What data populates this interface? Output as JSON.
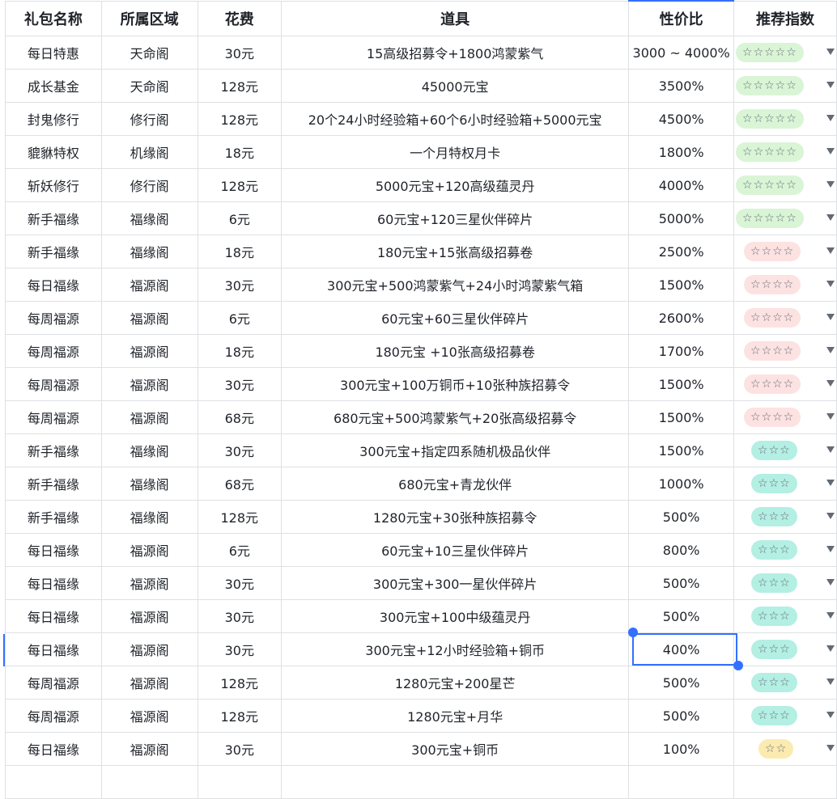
{
  "headers": [
    "礼包名称",
    "所属区域",
    "花费",
    "道具",
    "性价比",
    "推荐指数"
  ],
  "rows": [
    {
      "name": "每日特惠",
      "area": "天命阁",
      "cost": "30元",
      "items": "15高级招募令+1800鸿蒙紫气",
      "ratio": "3000 ~ 4000%",
      "stars": "☆☆☆☆☆",
      "color": "green"
    },
    {
      "name": "成长基金",
      "area": "天命阁",
      "cost": "128元",
      "items": "45000元宝",
      "ratio": "3500%",
      "stars": "☆☆☆☆☆",
      "color": "green"
    },
    {
      "name": "封鬼修行",
      "area": "修行阁",
      "cost": "128元",
      "items": "20个24小时经验箱+60个6小时经验箱+5000元宝",
      "ratio": "4500%",
      "stars": "☆☆☆☆☆",
      "color": "green"
    },
    {
      "name": "貔貅特权",
      "area": "机缘阁",
      "cost": "18元",
      "items": "一个月特权月卡",
      "ratio": "1800%",
      "stars": "☆☆☆☆☆",
      "color": "green"
    },
    {
      "name": "斩妖修行",
      "area": "修行阁",
      "cost": "128元",
      "items": "5000元宝+120高级蕴灵丹",
      "ratio": "4000%",
      "stars": "☆☆☆☆☆",
      "color": "green"
    },
    {
      "name": "新手福缘",
      "area": "福缘阁",
      "cost": "6元",
      "items": "60元宝+120三星伙伴碎片",
      "ratio": "5000%",
      "stars": "☆☆☆☆☆",
      "color": "green"
    },
    {
      "name": "新手福缘",
      "area": "福缘阁",
      "cost": "18元",
      "items": "180元宝+15张高级招募卷",
      "ratio": "2500%",
      "stars": "☆☆☆☆",
      "color": "pink"
    },
    {
      "name": "每日福缘",
      "area": "福源阁",
      "cost": "30元",
      "items": "300元宝+500鸿蒙紫气+24小时鸿蒙紫气箱",
      "ratio": "1500%",
      "stars": "☆☆☆☆",
      "color": "pink"
    },
    {
      "name": "每周福源",
      "area": "福源阁",
      "cost": "6元",
      "items": "60元宝+60三星伙伴碎片",
      "ratio": "2600%",
      "stars": "☆☆☆☆",
      "color": "pink"
    },
    {
      "name": "每周福源",
      "area": "福源阁",
      "cost": "18元",
      "items": "180元宝 +10张高级招募卷",
      "ratio": "1700%",
      "stars": "☆☆☆☆",
      "color": "pink"
    },
    {
      "name": "每周福源",
      "area": "福源阁",
      "cost": "30元",
      "items": "300元宝+100万铜币+10张种族招募令",
      "ratio": "1500%",
      "stars": "☆☆☆☆",
      "color": "pink"
    },
    {
      "name": "每周福源",
      "area": "福源阁",
      "cost": "68元",
      "items": "680元宝+500鸿蒙紫气+20张高级招募令",
      "ratio": "1500%",
      "stars": "☆☆☆☆",
      "color": "pink"
    },
    {
      "name": "新手福缘",
      "area": "福缘阁",
      "cost": "30元",
      "items": "300元宝+指定四系随机极品伙伴",
      "ratio": "1500%",
      "stars": "☆☆☆",
      "color": "teal"
    },
    {
      "name": "新手福缘",
      "area": "福缘阁",
      "cost": "68元",
      "items": "680元宝+青龙伙伴",
      "ratio": "1000%",
      "stars": "☆☆☆",
      "color": "teal"
    },
    {
      "name": "新手福缘",
      "area": "福缘阁",
      "cost": "128元",
      "items": "1280元宝+30张种族招募令",
      "ratio": "500%",
      "stars": "☆☆☆",
      "color": "teal"
    },
    {
      "name": "每日福缘",
      "area": "福源阁",
      "cost": "6元",
      "items": "60元宝+10三星伙伴碎片",
      "ratio": "800%",
      "stars": "☆☆☆",
      "color": "teal"
    },
    {
      "name": "每日福缘",
      "area": "福源阁",
      "cost": "30元",
      "items": "300元宝+300一星伙伴碎片",
      "ratio": "500%",
      "stars": "☆☆☆",
      "color": "teal"
    },
    {
      "name": "每日福缘",
      "area": "福源阁",
      "cost": "30元",
      "items": "300元宝+100中级蕴灵丹",
      "ratio": "500%",
      "stars": "☆☆☆",
      "color": "teal"
    },
    {
      "name": "每日福缘",
      "area": "福源阁",
      "cost": "30元",
      "items": "300元宝+12小时经验箱+铜币",
      "ratio": "400%",
      "stars": "☆☆☆",
      "color": "teal"
    },
    {
      "name": "每周福源",
      "area": "福源阁",
      "cost": "128元",
      "items": "1280元宝+200星芒",
      "ratio": "500%",
      "stars": "☆☆☆",
      "color": "teal"
    },
    {
      "name": "每周福源",
      "area": "福源阁",
      "cost": "128元",
      "items": "1280元宝+月华",
      "ratio": "500%",
      "stars": "☆☆☆",
      "color": "teal"
    },
    {
      "name": "每日福缘",
      "area": "福源阁",
      "cost": "30元",
      "items": "300元宝+铜币",
      "ratio": "100%",
      "stars": "☆☆",
      "color": "yellow"
    }
  ],
  "colors": {
    "accent": "#3370ff",
    "green": "#d9f5d6",
    "pink": "#fde2e2",
    "teal": "#b3efe3",
    "yellow": "#fcebb0",
    "grid_line": "#dee0e3"
  },
  "icons": {
    "dropdown": "chevron-down-icon",
    "selection_handle": "selection-handle-icon"
  }
}
